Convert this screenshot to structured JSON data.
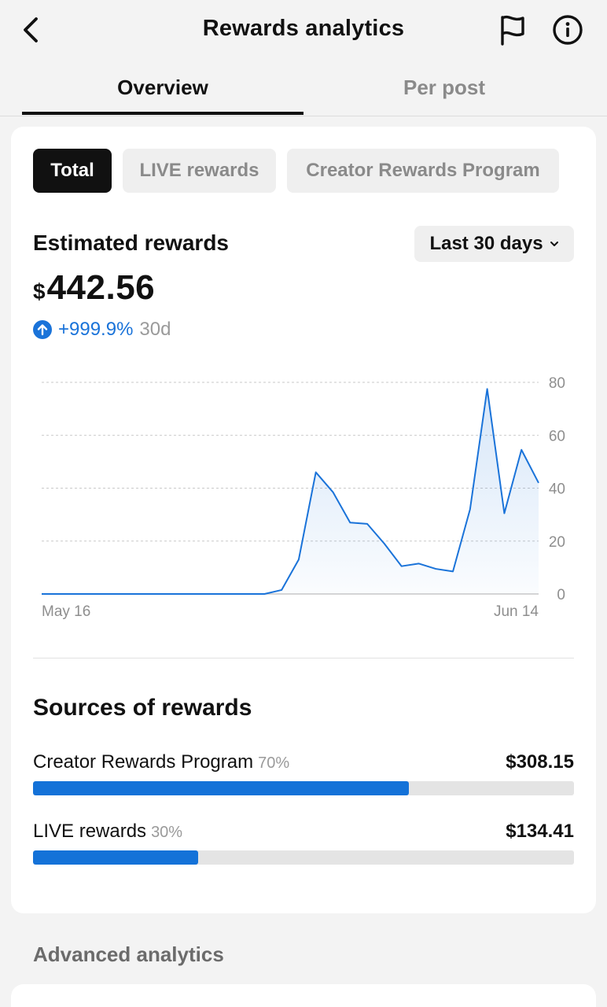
{
  "header": {
    "title": "Rewards analytics",
    "back_icon": "chevron-left-icon",
    "flag_icon": "flag-icon",
    "info_icon": "info-icon"
  },
  "tabs": [
    {
      "label": "Overview",
      "active": true
    },
    {
      "label": "Per post",
      "active": false
    }
  ],
  "filters": [
    {
      "label": "Total",
      "selected": true
    },
    {
      "label": "LIVE rewards",
      "selected": false
    },
    {
      "label": "Creator Rewards Program",
      "selected": false
    }
  ],
  "estimated": {
    "label": "Estimated rewards",
    "currency": "$",
    "amount": "442.56",
    "change": "+999.9%",
    "period": "30d",
    "range": "Last 30 days",
    "up_icon": "arrow-up-circle-icon",
    "dropdown_icon": "chevron-down-icon"
  },
  "colors": {
    "accent": "#1472d8",
    "line": "#1a73d9"
  },
  "chart_data": {
    "type": "area",
    "x_start_label": "May 16",
    "x_end_label": "Jun 14",
    "ylim": [
      0,
      80
    ],
    "yticks": [
      0,
      20,
      40,
      60,
      80
    ],
    "grid": true,
    "y_axis_position": "right",
    "series": [
      {
        "values": [
          0,
          0,
          0,
          0,
          0,
          0,
          0,
          0,
          0,
          0,
          0,
          0,
          0,
          0,
          1.5,
          13,
          46,
          38.5,
          27,
          26.5,
          19,
          10.5,
          11.5,
          9.5,
          8.5,
          32,
          77.5,
          30.5,
          54.5,
          42
        ]
      }
    ]
  },
  "sources": {
    "title": "Sources of rewards",
    "items": [
      {
        "label": "Creator Rewards Program",
        "pct": "70%",
        "value": "$308.15",
        "fraction": 0.695
      },
      {
        "label": "LIVE rewards",
        "pct": "30%",
        "value": "$134.41",
        "fraction": 0.305
      }
    ]
  },
  "advanced": {
    "title": "Advanced analytics"
  }
}
